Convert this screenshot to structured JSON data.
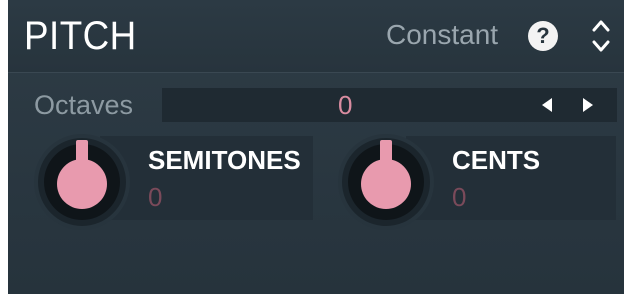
{
  "header": {
    "title": "PITCH",
    "mode": "Constant",
    "help_label": "?",
    "help_icon": "help-icon",
    "mode_icon": "up-down-chevron-icon"
  },
  "octaves": {
    "label": "Octaves",
    "value": "0",
    "left_icon": "arrow-left-icon",
    "right_icon": "arrow-right-icon"
  },
  "knobs": [
    {
      "name": "SEMITONES",
      "value": "0",
      "level": 0.5
    },
    {
      "name": "CENTS",
      "value": "0",
      "level": 0.5
    }
  ],
  "colors": {
    "panel_bg": "#2b3842",
    "knob_fill": "#e89aae",
    "value_pink": "#d98ca0",
    "text_white": "#ffffff",
    "text_grey": "#9aa6ae"
  }
}
